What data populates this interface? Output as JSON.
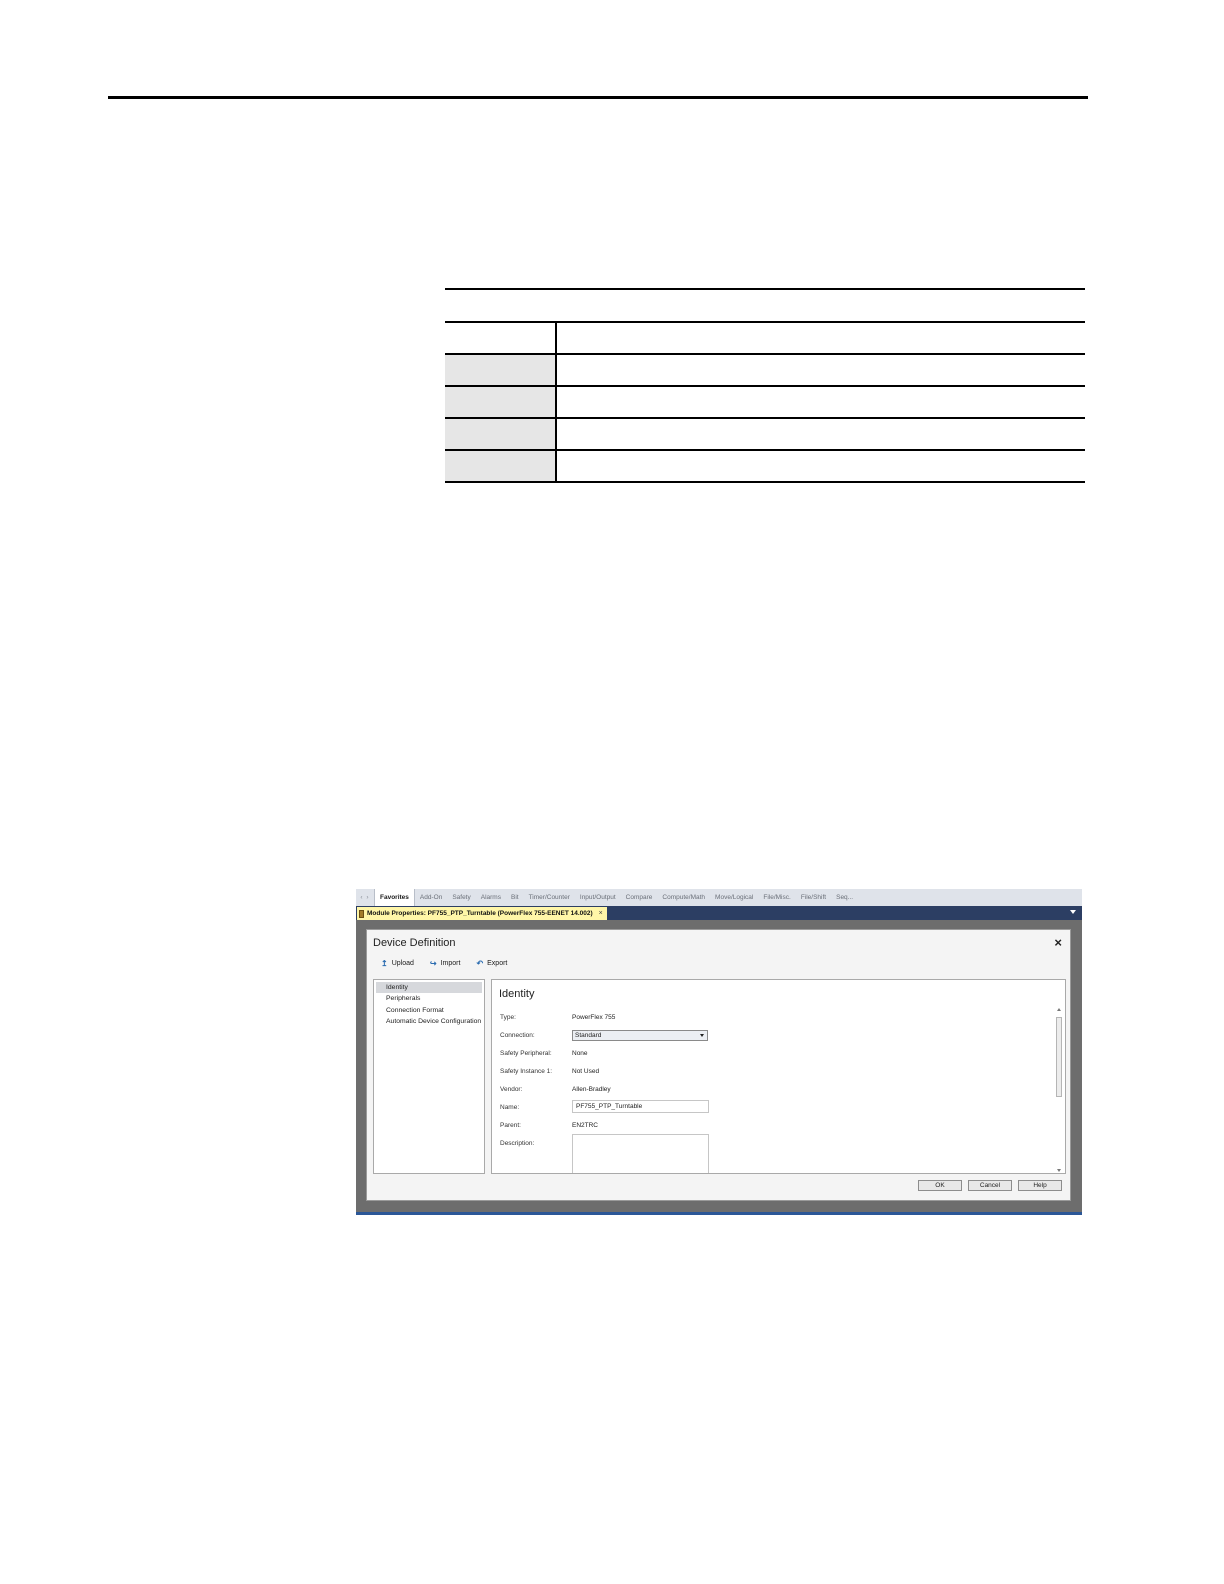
{
  "ribbon": {
    "nav": "‹ ›",
    "tabs": [
      "Favorites",
      "Add-On",
      "Safety",
      "Alarms",
      "Bit",
      "Timer/Counter",
      "Input/Output",
      "Compare",
      "Compute/Math",
      "Move/Logical",
      "File/Misc.",
      "File/Shift",
      "Seq..."
    ],
    "active_tab": 0
  },
  "document_tab": {
    "label": "Module Properties: PF755_PTP_Turntable (PowerFlex 755-EENET 14.002)",
    "close": "×"
  },
  "dialog": {
    "title": "Device Definition",
    "close": "×",
    "toolbar": {
      "upload": "Upload",
      "import": "Import",
      "export": "Export"
    },
    "nav_items": [
      "Identity",
      "Peripherals",
      "Connection Format",
      "Automatic Device Configuration"
    ],
    "selected_nav": 0,
    "section_title": "Identity",
    "fields": {
      "type_label": "Type:",
      "type_value": "PowerFlex 755",
      "connection_label": "Connection:",
      "connection_value": "Standard",
      "safety_peripheral_label": "Safety Peripheral:",
      "safety_peripheral_value": "None",
      "safety_instance_label": "Safety Instance 1:",
      "safety_instance_value": "Not Used",
      "vendor_label": "Vendor:",
      "vendor_value": "Allen-Bradley",
      "name_label": "Name:",
      "name_value": "PF755_PTP_Turntable",
      "parent_label": "Parent:",
      "parent_value": "EN2TRC",
      "description_label": "Description:"
    },
    "buttons": {
      "ok": "OK",
      "cancel": "Cancel",
      "help": "Help"
    }
  },
  "colors": {
    "doc_tab_bar": "#2c3e63",
    "doc_tab_active": "#fff6a8",
    "screenshot_border": "#2b5797",
    "table_shade": "#e6e6e6"
  },
  "icons": [
    "upload-icon",
    "import-icon",
    "export-icon",
    "close-icon",
    "dropdown-arrow-icon",
    "module-icon"
  ]
}
